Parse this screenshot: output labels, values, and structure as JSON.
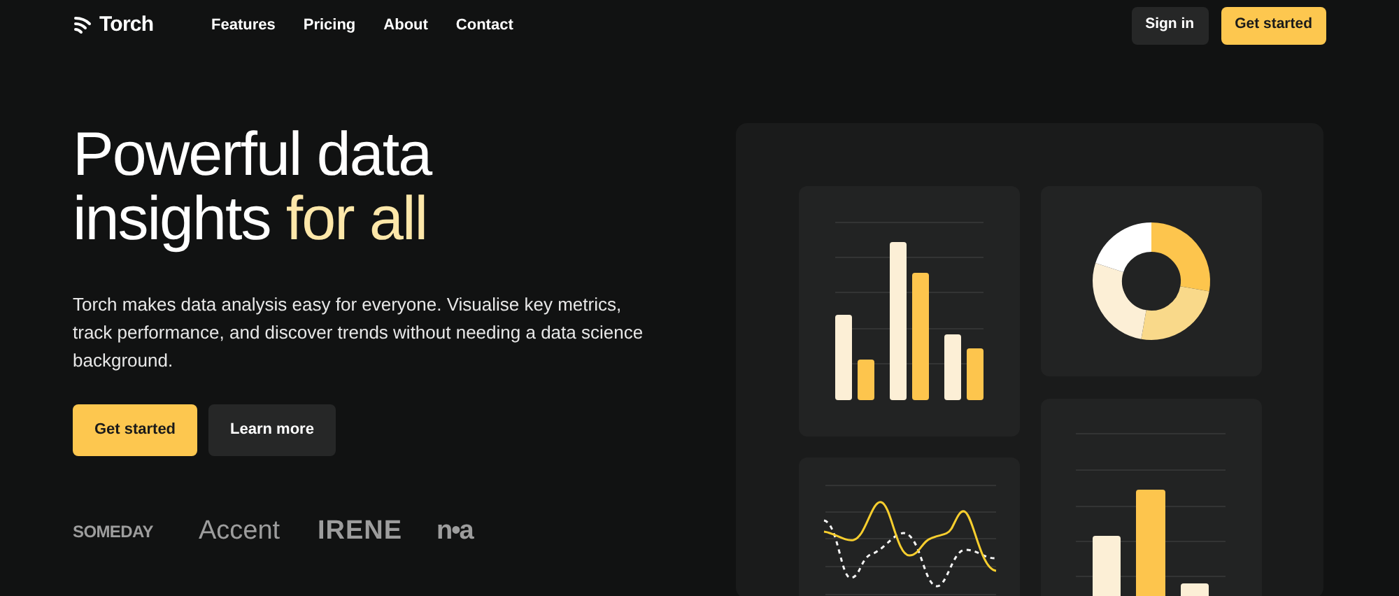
{
  "brand": {
    "name": "Torch"
  },
  "nav": {
    "links": [
      "Features",
      "Pricing",
      "About",
      "Contact"
    ]
  },
  "header_actions": [
    {
      "label": "Sign in",
      "kind": "secondary"
    },
    {
      "label": "Get started",
      "kind": "primary"
    }
  ],
  "hero": {
    "title": [
      {
        "text": "Powerful data insights ",
        "highlight": false
      },
      {
        "text": "for all",
        "highlight": true
      }
    ],
    "description": "Torch makes data analysis easy for everyone. Visualise key metrics, track performance, and discover trends without needing a data science background.",
    "buttons": [
      {
        "label": "Get started",
        "kind": "primary"
      },
      {
        "label": "Learn more",
        "kind": "secondary"
      }
    ]
  },
  "logos": [
    "SOMEDAY",
    "Accent",
    "IRENE",
    "n•a"
  ]
}
